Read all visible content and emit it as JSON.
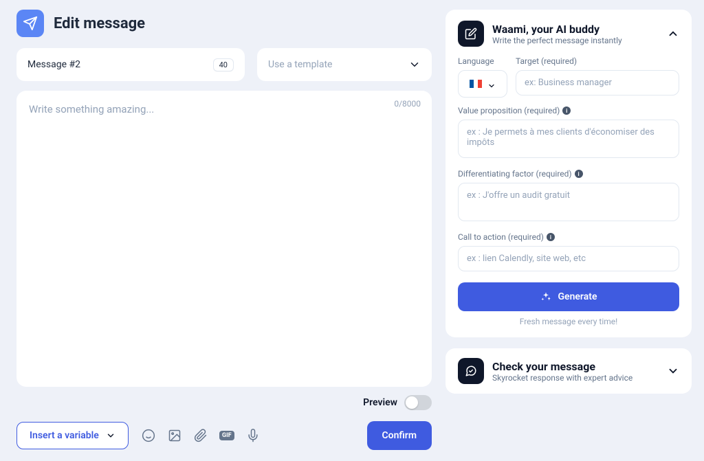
{
  "header": {
    "title": "Edit message"
  },
  "message_row": {
    "label": "Message #2",
    "badge": "40",
    "template_placeholder": "Use a template"
  },
  "editor": {
    "placeholder": "Write something amazing...",
    "counter": "0/8000"
  },
  "preview": {
    "label": "Preview",
    "on": false
  },
  "bottom": {
    "insert_label": "Insert a variable",
    "confirm_label": "Confirm"
  },
  "ai_panel": {
    "title": "Waami, your AI buddy",
    "subtitle": "Write the perfect message instantly",
    "language_label": "Language",
    "target_label": "Target (required)",
    "target_placeholder": "ex: Business manager",
    "value_prop_label": "Value proposition (required)",
    "value_prop_placeholder": "ex : Je permets à mes clients d'économiser des impôts",
    "diff_label": "Differentiating factor (required)",
    "diff_placeholder": "ex : J'offre un audit gratuit",
    "cta_label": "Call to action (required)",
    "cta_placeholder": "ex : lien Calendly, site web, etc",
    "generate_label": "Generate",
    "subnote": "Fresh message every time!",
    "flag": "france"
  },
  "check_panel": {
    "title": "Check your message",
    "subtitle": "Skyrocket response with expert advice"
  }
}
